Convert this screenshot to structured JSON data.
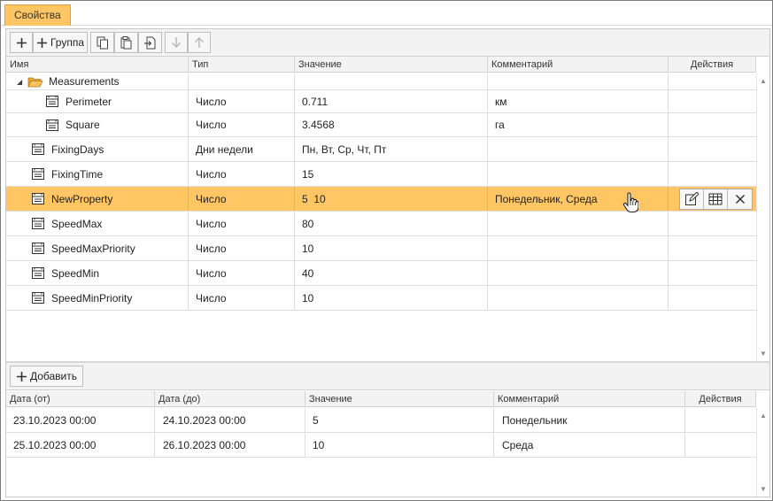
{
  "tab": {
    "label": "Свойства"
  },
  "toolbar": {
    "add_group_label": "Группа"
  },
  "props": {
    "columns": [
      "Имя",
      "Тип",
      "Значение",
      "Комментарий",
      "Действия"
    ],
    "group": {
      "name": "Measurements"
    },
    "rows": [
      {
        "name": "Perimeter",
        "type": "Число",
        "value": "0.711",
        "comment": "км"
      },
      {
        "name": "Square",
        "type": "Число",
        "value": "3.4568",
        "comment": "га"
      },
      {
        "name": "FixingDays",
        "type": "Дни недели",
        "value": "Пн, Вт, Ср, Чт, Пт",
        "comment": ""
      },
      {
        "name": "FixingTime",
        "type": "Число",
        "value": "15",
        "comment": ""
      },
      {
        "name": "NewProperty",
        "type": "Число",
        "value": "5  10",
        "comment": "Понедельник, Среда"
      },
      {
        "name": "SpeedMax",
        "type": "Число",
        "value": "80",
        "comment": ""
      },
      {
        "name": "SpeedMaxPriority",
        "type": "Число",
        "value": "10",
        "comment": ""
      },
      {
        "name": "SpeedMin",
        "type": "Число",
        "value": "40",
        "comment": ""
      },
      {
        "name": "SpeedMinPriority",
        "type": "Число",
        "value": "10",
        "comment": ""
      }
    ]
  },
  "values": {
    "add_label": "Добавить",
    "columns": [
      "Дата (от)",
      "Дата (до)",
      "Значение",
      "Комментарий",
      "Действия"
    ],
    "rows": [
      {
        "from": "23.10.2023 00:00",
        "to": "24.10.2023 00:00",
        "value": "5",
        "comment": "Понедельник"
      },
      {
        "from": "25.10.2023 00:00",
        "to": "26.10.2023 00:00",
        "value": "10",
        "comment": "Среда"
      }
    ]
  },
  "colors": {
    "accent": "#ffc663"
  },
  "icons": {
    "add": "plus-icon",
    "copy": "copy-icon",
    "paste": "paste-icon",
    "import": "import-icon",
    "move_down": "arrow-down-icon",
    "move_up": "arrow-up-icon",
    "folder": "folder-icon",
    "property": "property-icon",
    "edit": "edit-icon",
    "table": "table-icon",
    "delete": "close-icon"
  }
}
